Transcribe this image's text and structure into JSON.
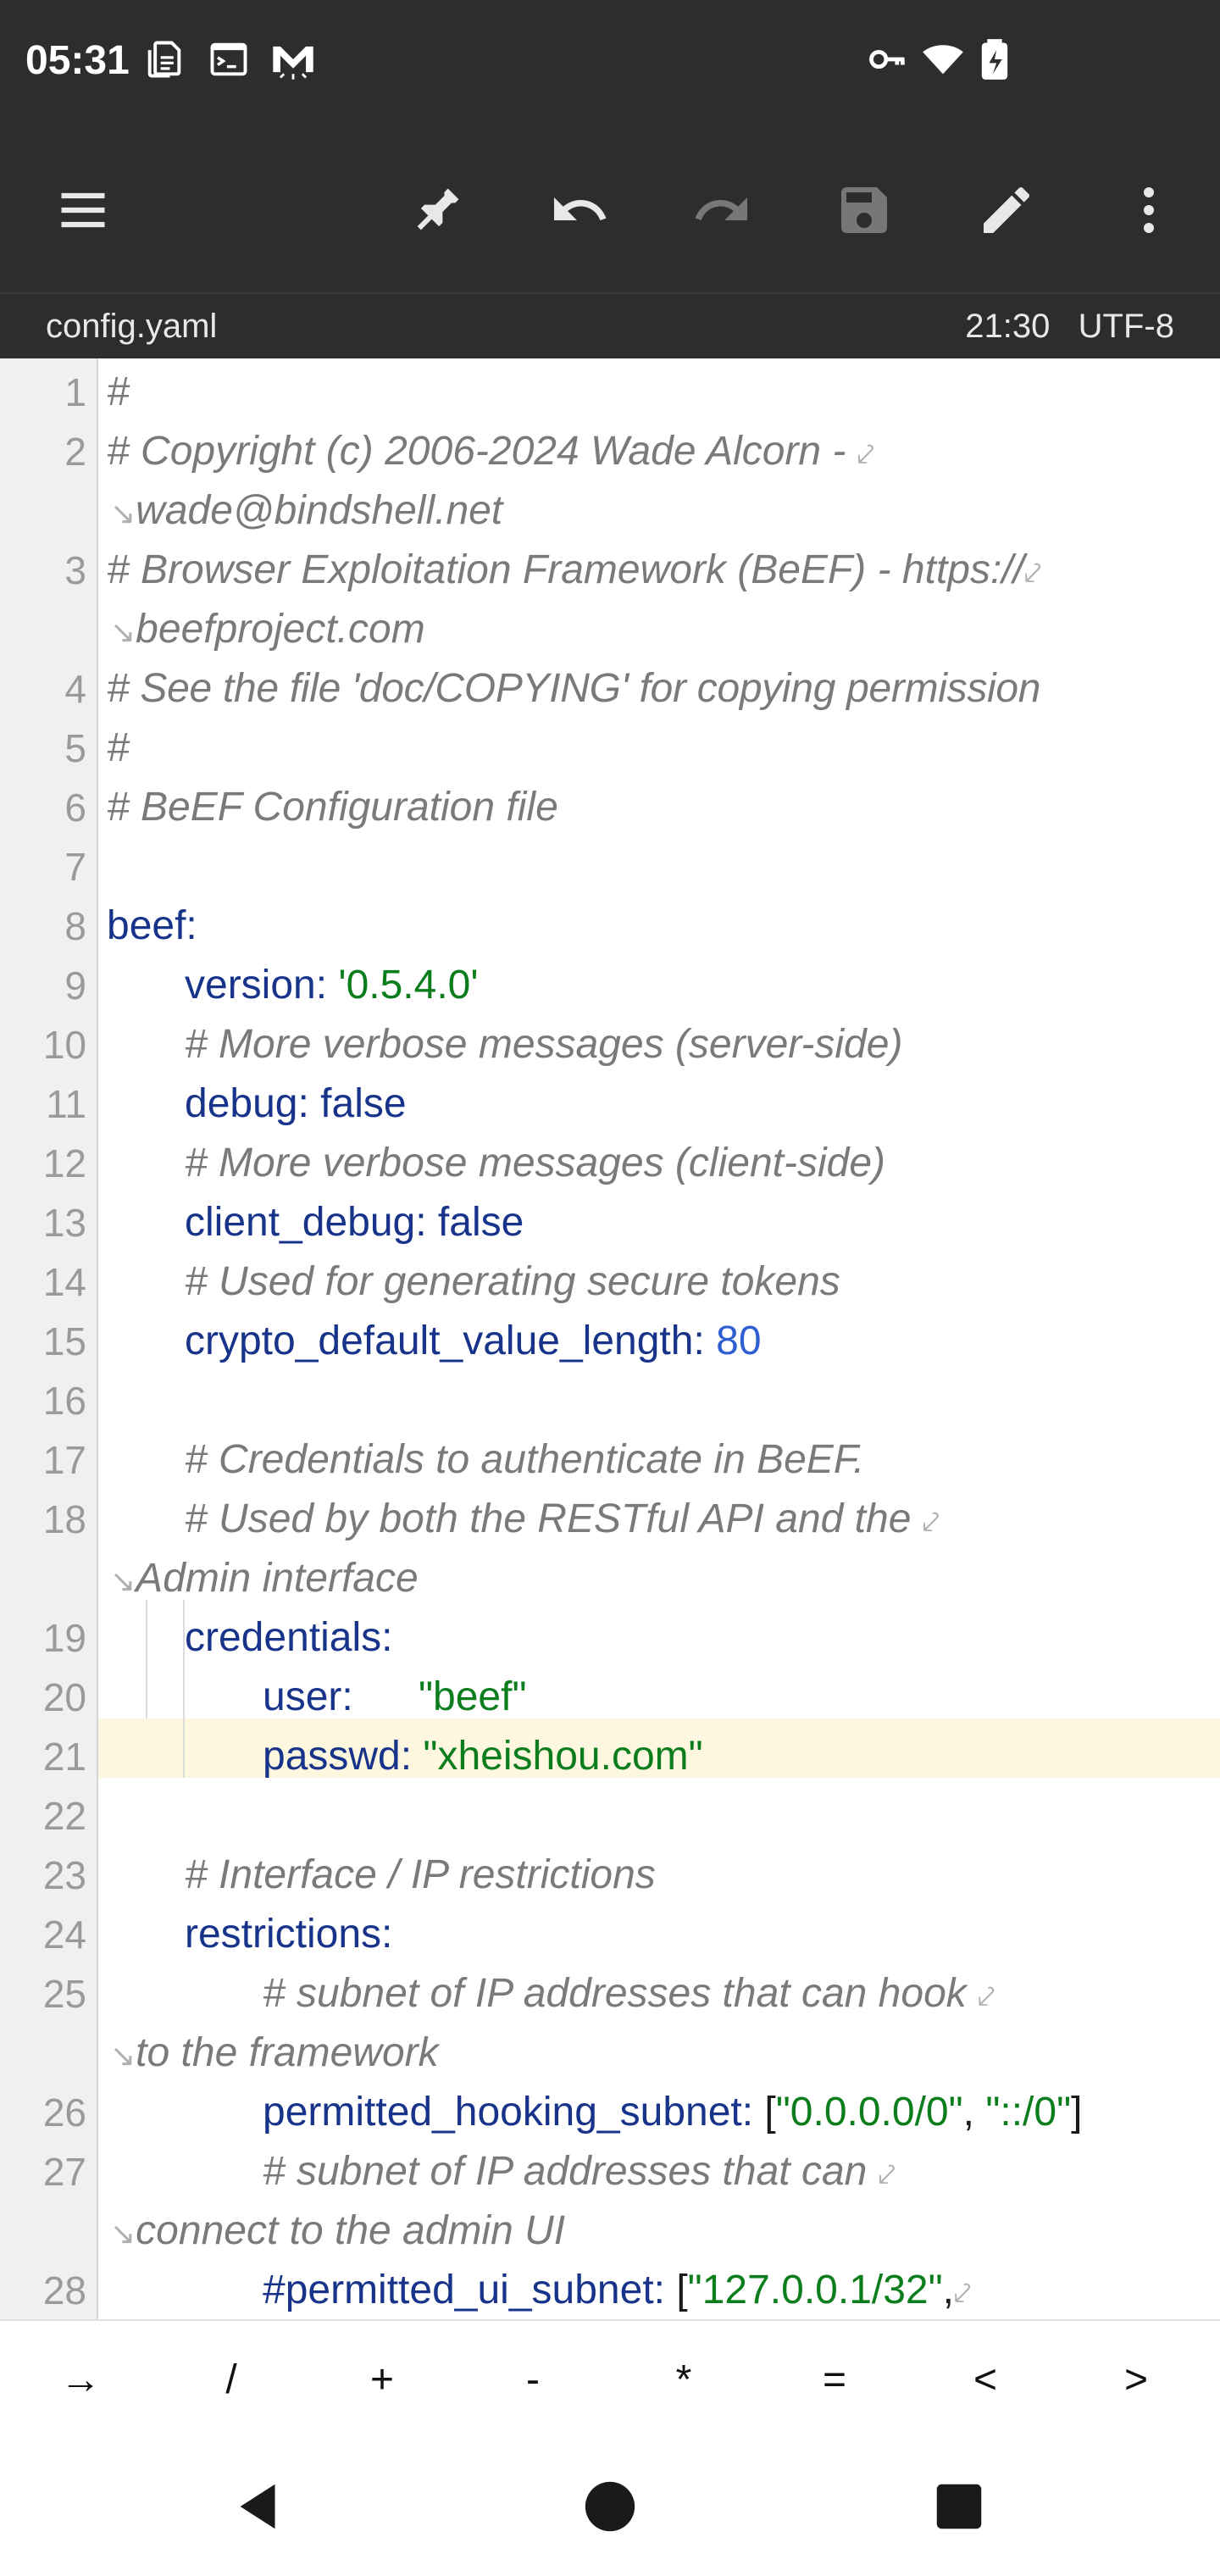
{
  "status_bar": {
    "time": "05:31"
  },
  "file_info": {
    "filename": "config.yaml",
    "position": "21:30",
    "encoding": "UTF-8"
  },
  "editor": {
    "line_numbers": [
      "1",
      "2",
      "3",
      "4",
      "5",
      "6",
      "7",
      "8",
      "9",
      "10",
      "11",
      "12",
      "13",
      "14",
      "15",
      "16",
      "17",
      "18",
      "19",
      "20",
      "21",
      "22",
      "23",
      "24",
      "25",
      "26",
      "27",
      "28"
    ],
    "lines": {
      "l1": "#",
      "l2a": "# Copyright (c) 2006-2024 Wade Alcorn - ",
      "l2b": "wade@bindshell.net",
      "l3a": "# Browser Exploitation Framework (BeEF) - https://",
      "l3b": "beefproject.com",
      "l4": "# See the file 'doc/COPYING' for copying permission",
      "l5": "#",
      "l6": "# BeEF Configuration file",
      "l8": "beef:",
      "l9_key": "version: ",
      "l9_val": "'0.5.4.0'",
      "l10": "# More verbose messages (server-side)",
      "l11_key": "debug: ",
      "l11_val": "false",
      "l12": "# More verbose messages (client-side)",
      "l13_key": "client_debug: ",
      "l13_val": "false",
      "l14": "# Used for generating secure tokens",
      "l15_key": "crypto_default_value_length: ",
      "l15_val": "80",
      "l17": "# Credentials to authenticate in BeEF.",
      "l18a": "# Used by both the RESTful API and the ",
      "l18b": "Admin interface",
      "l19_key": "credentials:",
      "l20_key": "user:",
      "l20_val": "\"beef\"",
      "l21_key": "passwd: ",
      "l21_val": "\"xheishou.com\"",
      "l23": "# Interface / IP restrictions",
      "l24_key": "restrictions:",
      "l25a": "# subnet of IP addresses that can hook ",
      "l25b": "to the framework",
      "l26_key": "permitted_hooking_subnet: ",
      "l26_open": "[",
      "l26_v1": "\"0.0.0.0/0\"",
      "l26_sep": ", ",
      "l26_v2": "\"::/0\"",
      "l26_close": "]",
      "l27a": "# subnet of IP addresses that can ",
      "l27b": "connect to the admin UI",
      "l28_key": "#permitted_ui_subnet: ",
      "l28_open": "[",
      "l28_v1": "\"127.0.0.1/32\"",
      "l28_sep": ","
    },
    "wrap_start_glyph": "↘",
    "wrap_end_glyph": "⤦"
  },
  "symbol_keys": [
    "→",
    "/",
    "+",
    "-",
    "*",
    "=",
    "<",
    ">"
  ],
  "colors": {
    "bar_bg": "#2d2d2d",
    "comment": "#7a7a7a",
    "key": "#17338a",
    "string": "#0b7d1c",
    "number": "#2f5fd0",
    "highlight": "#fdf7df"
  }
}
